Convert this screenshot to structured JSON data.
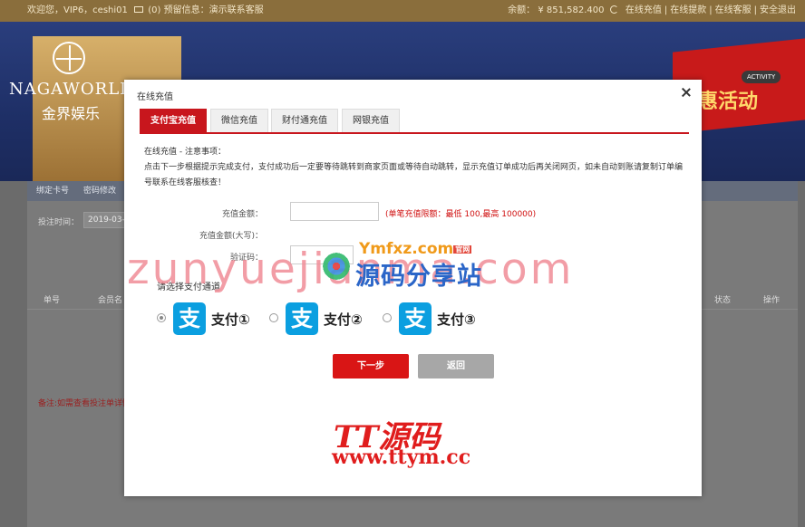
{
  "topbar": {
    "greeting": "欢迎您，VIP6，ceshi01",
    "mail_count": "(0)",
    "notice": "预留信息：演示联系客服",
    "balance_label": "余额：",
    "balance_value": "¥ 851,582.400",
    "links": [
      "在线充值",
      "在线提款",
      "在线客服",
      "安全退出"
    ]
  },
  "banner": {
    "brand_en": "NAGAWORLD",
    "brand_cn": "金界娱乐",
    "promo_text": "惠活动",
    "activity_badge": "ACTIVITY"
  },
  "background": {
    "subnav": [
      "绑定卡号",
      "密码修改"
    ],
    "query_label": "投注时间：",
    "date_value": "2019-03-",
    "columns": [
      "单号",
      "会员名",
      "状态",
      "操作"
    ],
    "footnote": "备注:如需查看投注单详情"
  },
  "modal": {
    "title": "在线充值",
    "tabs": [
      {
        "label": "支付宝充值",
        "active": true
      },
      {
        "label": "微信充值",
        "active": false
      },
      {
        "label": "财付通充值",
        "active": false
      },
      {
        "label": "网银充值",
        "active": false
      }
    ],
    "notice_title": "在线充值 - 注意事项：",
    "notice_body": "点击下一步根据提示完成支付，支付成功后一定要等待跳转到商家页面或等待自动跳转，显示充值订单成功后再关闭网页，如未自动到账请复制订单编号联系在线客服核查！",
    "form": {
      "amount_label": "充值金额：",
      "amount_value": "",
      "limit_note": "(单笔充值限额：最低 100,最高 100000)",
      "amount_upper_label": "充值金额(大写)：",
      "captcha_label": "验证码：",
      "captcha_value": ""
    },
    "channel_title": "请选择支付通道",
    "channels": [
      {
        "label": "支付①",
        "selected": true
      },
      {
        "label": "支付②",
        "selected": false
      },
      {
        "label": "支付③",
        "selected": false
      }
    ],
    "channel_logo_glyph": "支",
    "next_button": "下一步",
    "back_button": "返回"
  },
  "watermarks": {
    "site1": "zunyuejianma.com",
    "site2_top": "Ymfxz.com",
    "site2_badge": "官网",
    "site2_name": "源码分享站",
    "site3_name": "TT源码",
    "site3_url": "www.ttym.cc"
  },
  "icons": {
    "mail": "mail-icon",
    "refresh": "refresh-icon",
    "close": "close-icon",
    "alipay": "alipay-icon"
  },
  "colors": {
    "accent": "#c8161d",
    "topbar": "#8a6e3c",
    "alipay_blue": "#0b9fe0",
    "limit_text": "#d01010"
  }
}
